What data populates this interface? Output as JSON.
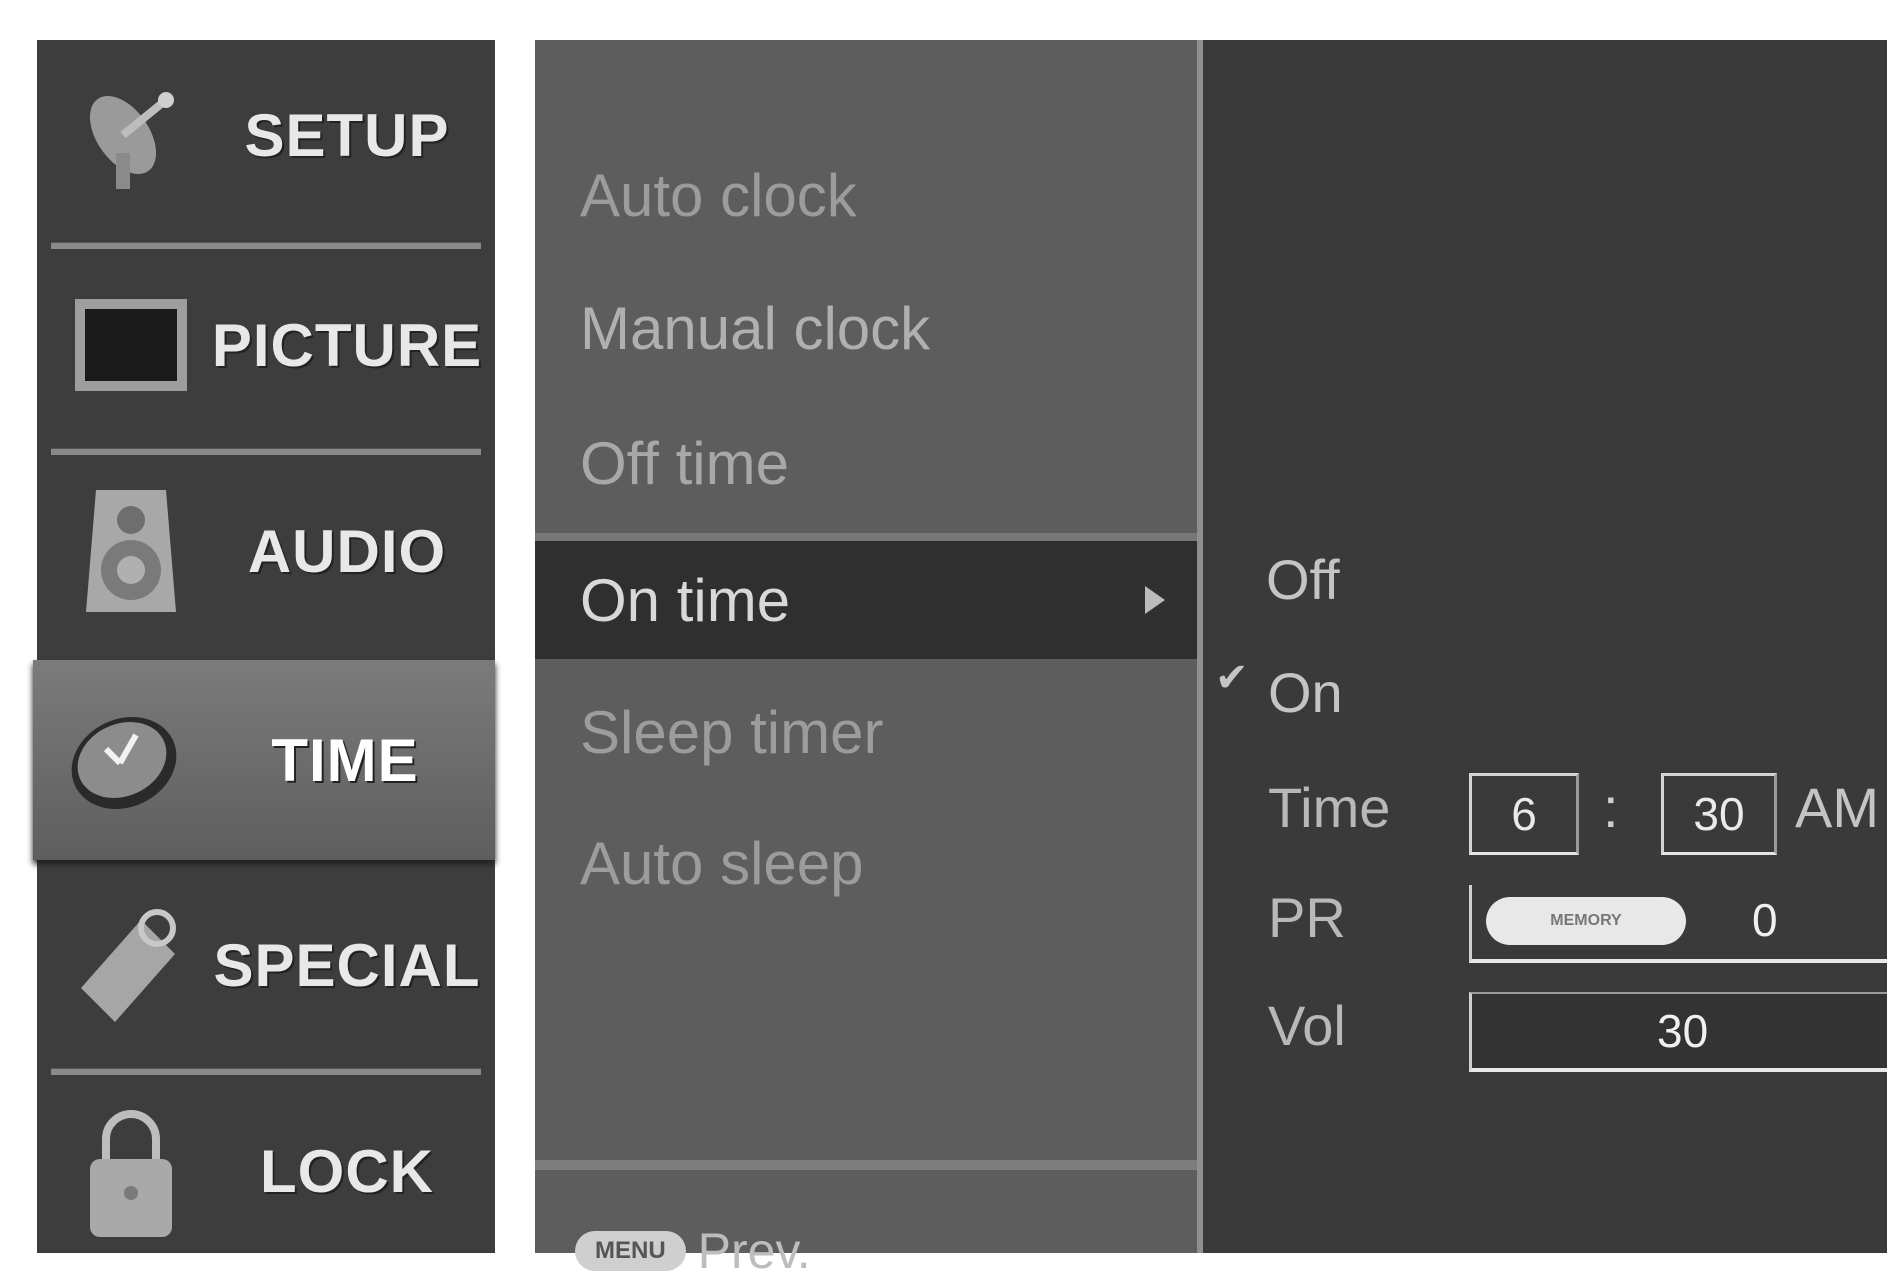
{
  "categories": [
    {
      "label": "SETUP",
      "icon": "satellite-dish-icon"
    },
    {
      "label": "PICTURE",
      "icon": "tv-screen-icon"
    },
    {
      "label": "AUDIO",
      "icon": "speaker-icon"
    },
    {
      "label": "TIME",
      "icon": "clock-icon",
      "selected": true
    },
    {
      "label": "SPECIAL",
      "icon": "tag-icon"
    },
    {
      "label": "LOCK",
      "icon": "padlock-icon"
    }
  ],
  "menu": {
    "items": [
      "Auto clock",
      "Manual clock",
      "Off time",
      "On time",
      "Sleep timer",
      "Auto sleep"
    ],
    "active_item": "On time",
    "footer": {
      "key_label": "MENU",
      "prev_label": "Prev."
    }
  },
  "on_time": {
    "options": [
      "Off",
      "On"
    ],
    "checked": "On",
    "time": {
      "label": "Time",
      "hour": "6",
      "separator": ":",
      "minute": "30",
      "ampm": "AM"
    },
    "pr": {
      "label": "PR",
      "pill_text": "MEMORY",
      "value": "0"
    },
    "vol": {
      "label": "Vol",
      "value": "30"
    }
  },
  "colors": {
    "left_panel": "#3d3d3d",
    "menu_panel": "#5d5d5d",
    "active_row": "#2f2f2f",
    "sub_panel": "#3a3a3a"
  }
}
